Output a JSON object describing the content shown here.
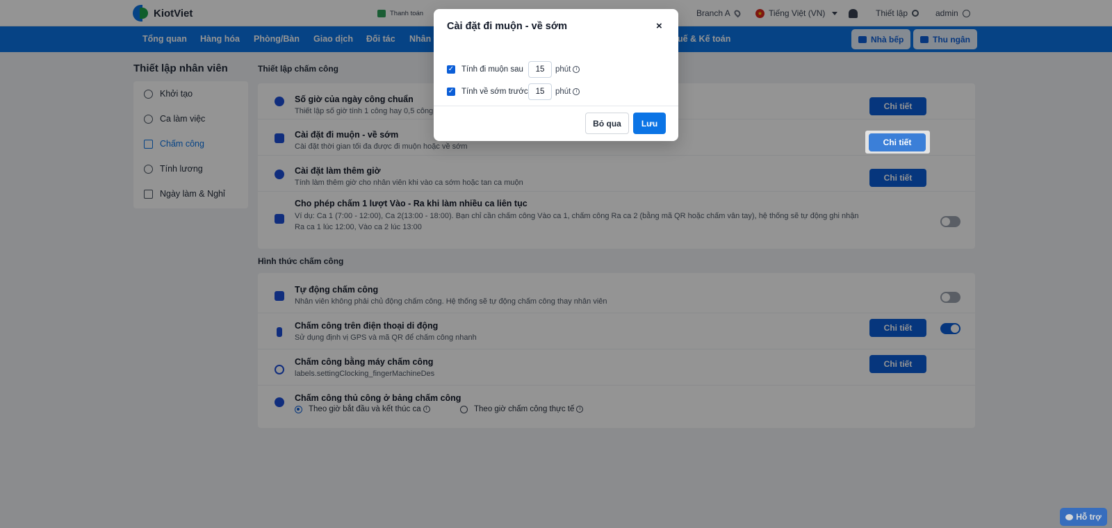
{
  "app": {
    "name": "KiotViet"
  },
  "topbar": {
    "payment_label": "Thanh toán",
    "branch": "Branch A",
    "language": "Tiếng Việt (VN)",
    "settings_label": "Thiết lập",
    "user": "admin"
  },
  "nav": {
    "items": [
      "Tổng quan",
      "Hàng hóa",
      "Phòng/Bàn",
      "Giao dịch",
      "Đối tác",
      "Nhân v",
      "uế & Kế toán"
    ],
    "kitchen_button": "Nhà bếp",
    "cashier_button": "Thu ngân"
  },
  "sidebar": {
    "title": "Thiết lập nhân viên",
    "items": [
      {
        "label": "Khởi tạo",
        "icon": "gear-icon"
      },
      {
        "label": "Ca làm việc",
        "icon": "clock-icon"
      },
      {
        "label": "Chấm công",
        "icon": "calendar-check-icon",
        "active": true
      },
      {
        "label": "Tính lương",
        "icon": "dollar-icon"
      },
      {
        "label": "Ngày làm & Nghỉ",
        "icon": "calendar-icon"
      }
    ]
  },
  "timekeeping_settings": {
    "title": "Thiết lập chấm công",
    "rows": [
      {
        "title": "Số giờ của ngày công chuẩn",
        "desc": "Thiết lập số giờ tính 1 công hay 0,5 công c",
        "button": "Chi tiết"
      },
      {
        "title": "Cài đặt đi muộn - về sớm",
        "desc": "Cài đặt thời gian tối đa được đi muộn hoặc về sớm",
        "button": "Chi tiết"
      },
      {
        "title": "Cài đặt làm thêm giờ",
        "desc": "Tính làm thêm giờ cho nhân viên khi vào ca sớm hoặc tan ca muộn",
        "button": "Chi tiết"
      },
      {
        "title": "Cho phép chấm 1 lượt Vào - Ra khi làm nhiều ca liên tục",
        "desc": "Ví dụ: Ca 1 (7:00 - 12:00), Ca 2(13:00 - 18:00). Bạn chỉ cần chấm công Vào ca 1, chấm công Ra ca 2 (bằng mã QR hoặc chấm vân tay), hệ thống sẽ tự động ghi nhận Ra ca 1 lúc 12:00, Vào ca 2 lúc 13:00",
        "toggle": false
      }
    ]
  },
  "timekeeping_methods": {
    "title": "Hình thức chấm công",
    "rows": [
      {
        "title": "Tự động chấm công",
        "desc": "Nhân viên không phải chủ động chấm công. Hệ thống sẽ tự động chấm công thay nhân viên",
        "toggle": false
      },
      {
        "title": "Chấm công trên điện thoại di động",
        "desc": "Sử dụng định vị GPS và mã QR để chấm công nhanh",
        "button": "Chi tiết",
        "toggle": true
      },
      {
        "title": "Chấm công bằng máy chấm công",
        "desc": "labels.settingClocking_fingerMachineDes",
        "button": "Chi tiết"
      },
      {
        "title": "Chấm công thủ công ở bảng chấm công",
        "options": [
          "Theo giờ bắt đầu và kết thúc ca",
          "Theo giờ chấm công thực tế"
        ],
        "selected": 0
      }
    ]
  },
  "modal": {
    "title": "Cài đặt đi muộn - về sớm",
    "close": "×",
    "late_label": "Tính đi muộn sau",
    "late_value": "15",
    "early_label": "Tính về sớm trước",
    "early_value": "15",
    "unit": "phút",
    "cancel": "Bỏ qua",
    "save": "Lưu"
  },
  "help": {
    "label": "Hỗ trợ"
  },
  "colors": {
    "primary": "#0b74e5",
    "button": "#0b5ed7",
    "background": "#f0f2f5"
  }
}
